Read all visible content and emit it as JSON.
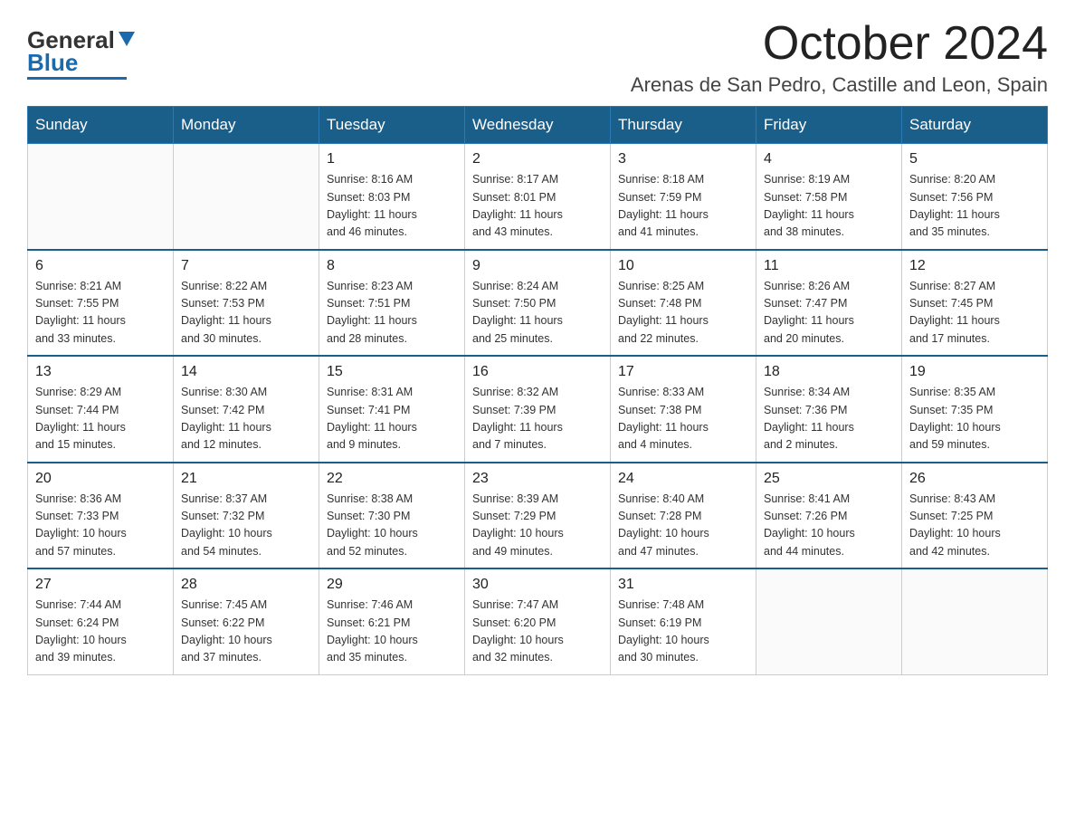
{
  "header": {
    "logo_text_black": "General",
    "logo_text_blue": "Blue",
    "month_title": "October 2024",
    "location": "Arenas de San Pedro, Castille and Leon, Spain"
  },
  "days_of_week": [
    "Sunday",
    "Monday",
    "Tuesday",
    "Wednesday",
    "Thursday",
    "Friday",
    "Saturday"
  ],
  "weeks": [
    [
      {
        "day": "",
        "info": ""
      },
      {
        "day": "",
        "info": ""
      },
      {
        "day": "1",
        "info": "Sunrise: 8:16 AM\nSunset: 8:03 PM\nDaylight: 11 hours\nand 46 minutes."
      },
      {
        "day": "2",
        "info": "Sunrise: 8:17 AM\nSunset: 8:01 PM\nDaylight: 11 hours\nand 43 minutes."
      },
      {
        "day": "3",
        "info": "Sunrise: 8:18 AM\nSunset: 7:59 PM\nDaylight: 11 hours\nand 41 minutes."
      },
      {
        "day": "4",
        "info": "Sunrise: 8:19 AM\nSunset: 7:58 PM\nDaylight: 11 hours\nand 38 minutes."
      },
      {
        "day": "5",
        "info": "Sunrise: 8:20 AM\nSunset: 7:56 PM\nDaylight: 11 hours\nand 35 minutes."
      }
    ],
    [
      {
        "day": "6",
        "info": "Sunrise: 8:21 AM\nSunset: 7:55 PM\nDaylight: 11 hours\nand 33 minutes."
      },
      {
        "day": "7",
        "info": "Sunrise: 8:22 AM\nSunset: 7:53 PM\nDaylight: 11 hours\nand 30 minutes."
      },
      {
        "day": "8",
        "info": "Sunrise: 8:23 AM\nSunset: 7:51 PM\nDaylight: 11 hours\nand 28 minutes."
      },
      {
        "day": "9",
        "info": "Sunrise: 8:24 AM\nSunset: 7:50 PM\nDaylight: 11 hours\nand 25 minutes."
      },
      {
        "day": "10",
        "info": "Sunrise: 8:25 AM\nSunset: 7:48 PM\nDaylight: 11 hours\nand 22 minutes."
      },
      {
        "day": "11",
        "info": "Sunrise: 8:26 AM\nSunset: 7:47 PM\nDaylight: 11 hours\nand 20 minutes."
      },
      {
        "day": "12",
        "info": "Sunrise: 8:27 AM\nSunset: 7:45 PM\nDaylight: 11 hours\nand 17 minutes."
      }
    ],
    [
      {
        "day": "13",
        "info": "Sunrise: 8:29 AM\nSunset: 7:44 PM\nDaylight: 11 hours\nand 15 minutes."
      },
      {
        "day": "14",
        "info": "Sunrise: 8:30 AM\nSunset: 7:42 PM\nDaylight: 11 hours\nand 12 minutes."
      },
      {
        "day": "15",
        "info": "Sunrise: 8:31 AM\nSunset: 7:41 PM\nDaylight: 11 hours\nand 9 minutes."
      },
      {
        "day": "16",
        "info": "Sunrise: 8:32 AM\nSunset: 7:39 PM\nDaylight: 11 hours\nand 7 minutes."
      },
      {
        "day": "17",
        "info": "Sunrise: 8:33 AM\nSunset: 7:38 PM\nDaylight: 11 hours\nand 4 minutes."
      },
      {
        "day": "18",
        "info": "Sunrise: 8:34 AM\nSunset: 7:36 PM\nDaylight: 11 hours\nand 2 minutes."
      },
      {
        "day": "19",
        "info": "Sunrise: 8:35 AM\nSunset: 7:35 PM\nDaylight: 10 hours\nand 59 minutes."
      }
    ],
    [
      {
        "day": "20",
        "info": "Sunrise: 8:36 AM\nSunset: 7:33 PM\nDaylight: 10 hours\nand 57 minutes."
      },
      {
        "day": "21",
        "info": "Sunrise: 8:37 AM\nSunset: 7:32 PM\nDaylight: 10 hours\nand 54 minutes."
      },
      {
        "day": "22",
        "info": "Sunrise: 8:38 AM\nSunset: 7:30 PM\nDaylight: 10 hours\nand 52 minutes."
      },
      {
        "day": "23",
        "info": "Sunrise: 8:39 AM\nSunset: 7:29 PM\nDaylight: 10 hours\nand 49 minutes."
      },
      {
        "day": "24",
        "info": "Sunrise: 8:40 AM\nSunset: 7:28 PM\nDaylight: 10 hours\nand 47 minutes."
      },
      {
        "day": "25",
        "info": "Sunrise: 8:41 AM\nSunset: 7:26 PM\nDaylight: 10 hours\nand 44 minutes."
      },
      {
        "day": "26",
        "info": "Sunrise: 8:43 AM\nSunset: 7:25 PM\nDaylight: 10 hours\nand 42 minutes."
      }
    ],
    [
      {
        "day": "27",
        "info": "Sunrise: 7:44 AM\nSunset: 6:24 PM\nDaylight: 10 hours\nand 39 minutes."
      },
      {
        "day": "28",
        "info": "Sunrise: 7:45 AM\nSunset: 6:22 PM\nDaylight: 10 hours\nand 37 minutes."
      },
      {
        "day": "29",
        "info": "Sunrise: 7:46 AM\nSunset: 6:21 PM\nDaylight: 10 hours\nand 35 minutes."
      },
      {
        "day": "30",
        "info": "Sunrise: 7:47 AM\nSunset: 6:20 PM\nDaylight: 10 hours\nand 32 minutes."
      },
      {
        "day": "31",
        "info": "Sunrise: 7:48 AM\nSunset: 6:19 PM\nDaylight: 10 hours\nand 30 minutes."
      },
      {
        "day": "",
        "info": ""
      },
      {
        "day": "",
        "info": ""
      }
    ]
  ]
}
